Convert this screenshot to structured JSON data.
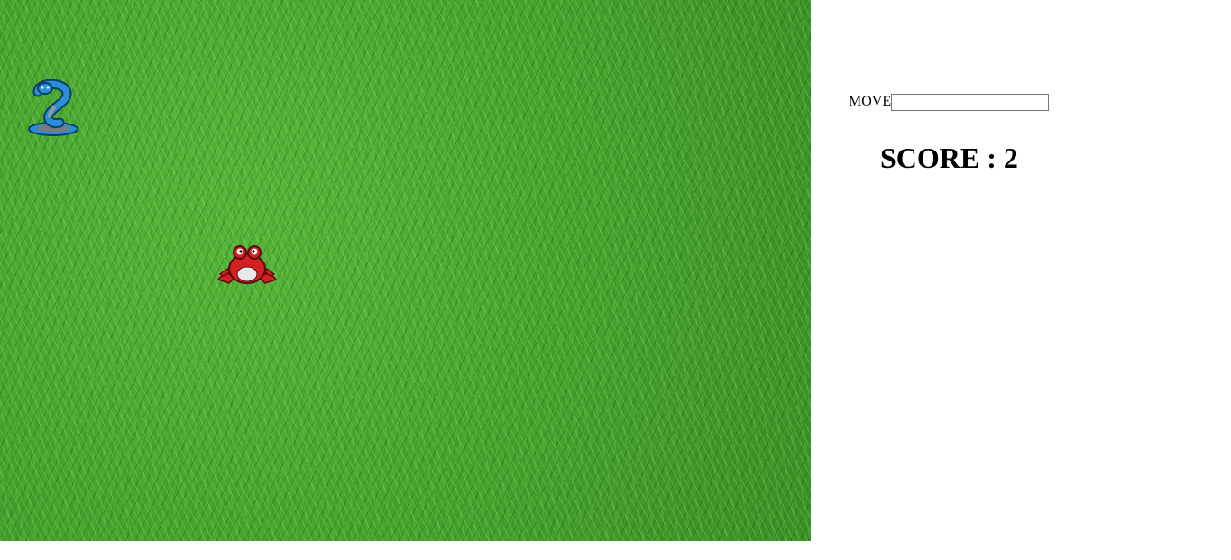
{
  "controls": {
    "move_label": "MOVE",
    "move_value": "",
    "move_placeholder": ""
  },
  "score": {
    "label": "SCORE",
    "separator": " : ",
    "value": "2"
  },
  "sprites": {
    "player": "snake-icon",
    "target": "frog-icon"
  },
  "colors": {
    "grass": "#4aa832",
    "snake": "#2a8fd6",
    "frog": "#d42020"
  }
}
